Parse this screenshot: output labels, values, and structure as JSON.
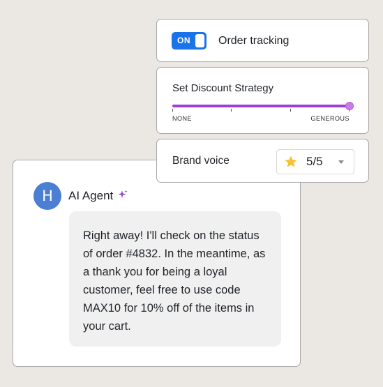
{
  "order_tracking": {
    "toggle_state": "ON",
    "label": "Order tracking"
  },
  "discount_strategy": {
    "title": "Set Discount Strategy",
    "min_label": "NONE",
    "max_label": "GENEROUS",
    "value_fraction": 1.0,
    "track_color": "#9b3fd6"
  },
  "brand_voice": {
    "label": "Brand voice",
    "rating": "5/5",
    "icon": "star-icon"
  },
  "chat": {
    "avatar_initial": "H",
    "agent_name": "AI Agent",
    "agent_icon": "sparkle-icon",
    "message": "Right away! I'll check on the status of order #4832. In the meantime, as a thank you for being a loyal customer, feel free to use code MAX10 for 10% off of the items in your cart."
  },
  "colors": {
    "background": "#ebe7e3",
    "toggle_on": "#1a73e8",
    "avatar": "#4a7fd4",
    "accent_purple": "#9b3fd6"
  }
}
